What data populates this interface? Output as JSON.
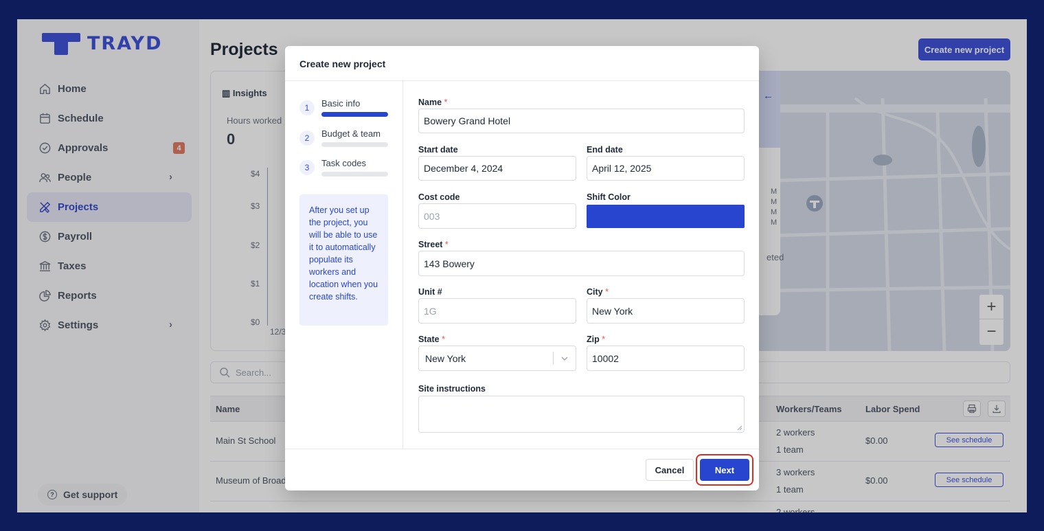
{
  "app": {
    "logo_text": "TRAYD"
  },
  "sidebar": {
    "items": [
      {
        "label": "Home",
        "icon": "home-icon"
      },
      {
        "label": "Schedule",
        "icon": "calendar-icon"
      },
      {
        "label": "Approvals",
        "icon": "check-circle-icon",
        "badge": "4"
      },
      {
        "label": "People",
        "icon": "people-icon",
        "chevron": "›"
      },
      {
        "label": "Projects",
        "icon": "tools-icon",
        "active": true
      },
      {
        "label": "Payroll",
        "icon": "dollar-icon"
      },
      {
        "label": "Taxes",
        "icon": "bank-icon"
      },
      {
        "label": "Reports",
        "icon": "pie-chart-icon"
      },
      {
        "label": "Settings",
        "icon": "gear-icon",
        "chevron": "›"
      }
    ],
    "support": {
      "label": "Get support",
      "icon_glyph": "?"
    }
  },
  "main": {
    "title": "Projects",
    "create_button": "Create new project",
    "insights": {
      "title": "Insights",
      "hours_label": "Hours worked",
      "hours_value": "0",
      "y_ticks": [
        "$4",
        "$3",
        "$2",
        "$1",
        "$0"
      ],
      "x_tick": "12/3"
    },
    "map": {
      "back_glyph": "←",
      "ampm": [
        "M",
        "M",
        "M",
        "M"
      ],
      "status_fragment": "eted",
      "zoom_in": "+",
      "zoom_out": "−"
    },
    "search": {
      "placeholder": "Search..."
    },
    "table": {
      "columns": [
        "Name",
        "Workers/Teams",
        "Labor Spend"
      ],
      "rows": [
        {
          "name": "Main St School",
          "workers": "2 workers",
          "teams": "1 team",
          "spend": "$0.00",
          "action": "See schedule"
        },
        {
          "name": "Museum of Broad",
          "workers": "3 workers",
          "teams": "1 team",
          "spend": "$0.00",
          "action": "See schedule"
        },
        {
          "workers": "2 workers"
        }
      ]
    }
  },
  "modal": {
    "title": "Create new project",
    "steps": [
      {
        "num": "1",
        "label": "Basic info",
        "active": true
      },
      {
        "num": "2",
        "label": "Budget & team"
      },
      {
        "num": "3",
        "label": "Task codes"
      }
    ],
    "info": "After you set up the project, you will be able to use it to automatically populate its workers and location when you create shifts.",
    "required_mark": "*",
    "fields": {
      "name": {
        "label": "Name",
        "value": "Bowery Grand Hotel"
      },
      "start_date": {
        "label": "Start date",
        "value": "December 4, 2024"
      },
      "end_date": {
        "label": "End date",
        "value": "April 12, 2025"
      },
      "cost_code": {
        "label": "Cost code",
        "placeholder": "003"
      },
      "shift_color": {
        "label": "Shift Color",
        "value": "#2845d0"
      },
      "street": {
        "label": "Street",
        "value": "143 Bowery"
      },
      "unit": {
        "label": "Unit #",
        "placeholder": "1G"
      },
      "city": {
        "label": "City",
        "value": "New York"
      },
      "state": {
        "label": "State",
        "value": "New York"
      },
      "zip": {
        "label": "Zip",
        "value": "10002"
      },
      "site_instructions": {
        "label": "Site instructions",
        "value": ""
      }
    },
    "cancel_label": "Cancel",
    "next_label": "Next"
  },
  "colors": {
    "frame": "#0f1c5c",
    "brand": "#3b50d6",
    "primary_button": "#2845d0",
    "highlight_ring": "#d93025",
    "badge": "#e07a5f"
  }
}
